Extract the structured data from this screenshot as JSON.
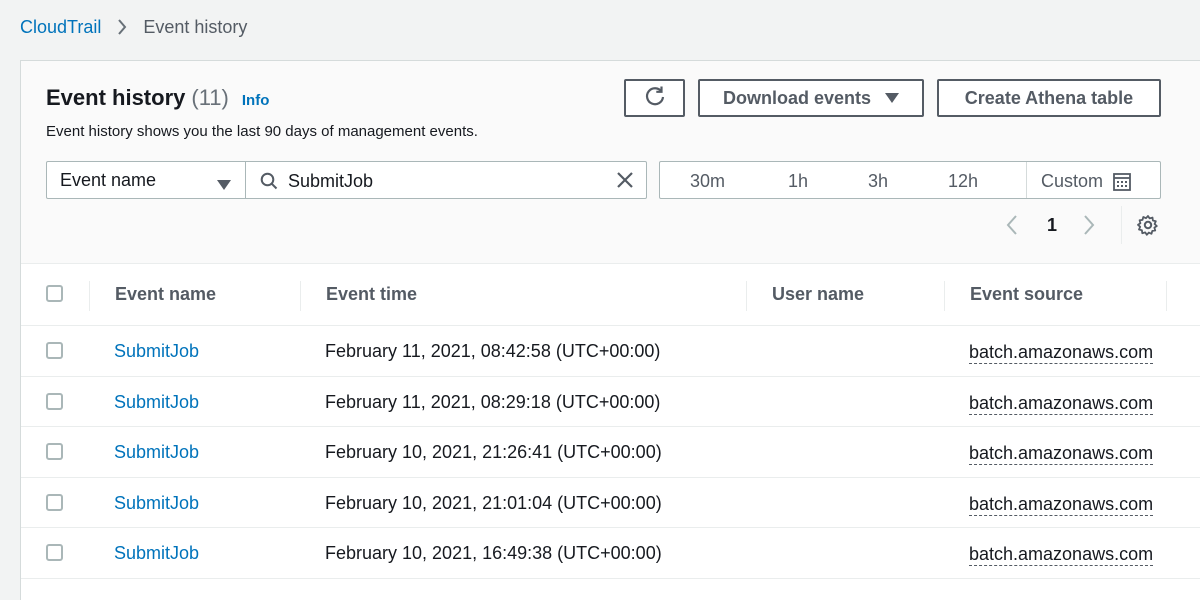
{
  "breadcrumb": {
    "root": "CloudTrail",
    "current": "Event history"
  },
  "panel": {
    "title": "Event history",
    "count": "(11)",
    "info": "Info",
    "description": "Event history shows you the last 90 days of management events."
  },
  "toolbar": {
    "download_label": "Download events",
    "athena_label": "Create Athena table"
  },
  "filter": {
    "attribute": "Event name",
    "search_value": "SubmitJob"
  },
  "time_range": {
    "options": [
      "30m",
      "1h",
      "3h",
      "12h"
    ],
    "custom_label": "Custom"
  },
  "pagination": {
    "current_page": "1"
  },
  "table": {
    "columns": [
      "Event name",
      "Event time",
      "User name",
      "Event source"
    ],
    "rows": [
      {
        "event_name": "SubmitJob",
        "event_time": "February 11, 2021, 08:42:58 (UTC+00:00)",
        "user_name": "",
        "event_source": "batch.amazonaws.com"
      },
      {
        "event_name": "SubmitJob",
        "event_time": "February 11, 2021, 08:29:18 (UTC+00:00)",
        "user_name": "",
        "event_source": "batch.amazonaws.com"
      },
      {
        "event_name": "SubmitJob",
        "event_time": "February 10, 2021, 21:26:41 (UTC+00:00)",
        "user_name": "",
        "event_source": "batch.amazonaws.com"
      },
      {
        "event_name": "SubmitJob",
        "event_time": "February 10, 2021, 21:01:04 (UTC+00:00)",
        "user_name": "",
        "event_source": "batch.amazonaws.com"
      },
      {
        "event_name": "SubmitJob",
        "event_time": "February 10, 2021, 16:49:38 (UTC+00:00)",
        "user_name": "",
        "event_source": "batch.amazonaws.com"
      }
    ]
  },
  "colors": {
    "link": "#0073bb",
    "text": "#16191f",
    "muted": "#545b64",
    "border": "#aab7b8"
  },
  "icons": [
    "chevron-right-icon",
    "refresh-icon",
    "caret-down-icon",
    "search-icon",
    "close-icon",
    "calendar-icon",
    "chevron-left-icon",
    "gear-icon"
  ]
}
